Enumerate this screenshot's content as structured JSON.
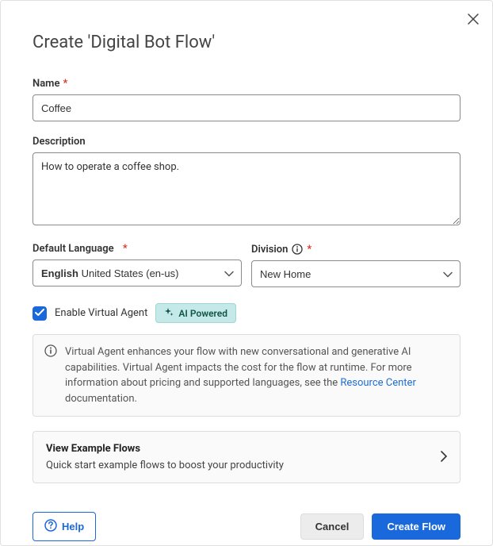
{
  "dialog": {
    "title": "Create 'Digital Bot Flow'"
  },
  "name": {
    "label": "Name",
    "value": "Coffee"
  },
  "description": {
    "label": "Description",
    "value": "How to operate a coffee shop."
  },
  "language": {
    "label": "Default Language",
    "selected_bold": "English",
    "selected_sub": "United States (en-us)"
  },
  "division": {
    "label": "Division",
    "selected": "New Home"
  },
  "virtual_agent": {
    "checkbox_label": "Enable Virtual Agent",
    "badge": "AI Powered"
  },
  "info": {
    "text_pre": "Virtual Agent enhances your flow with new conversational and generative AI capabilities. Virtual Agent impacts the cost for the flow at runtime. For more information about pricing and supported languages, see the ",
    "link": "Resource Center",
    "text_post": " documentation."
  },
  "example": {
    "title": "View Example Flows",
    "subtitle": "Quick start example flows to boost your productivity"
  },
  "footer": {
    "help": "Help",
    "cancel": "Cancel",
    "create": "Create Flow"
  }
}
